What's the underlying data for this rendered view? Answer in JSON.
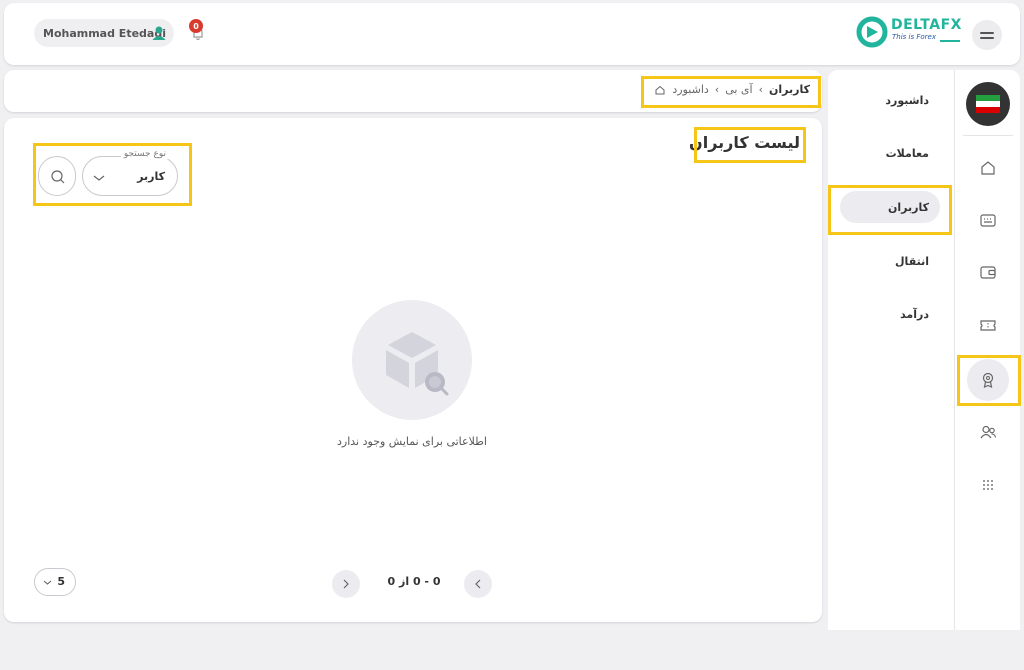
{
  "header": {
    "user_name": "Mohammad Etedadi",
    "notification_count": "0",
    "logo_name": "DELTAFX",
    "logo_tagline": "This is Forex"
  },
  "breadcrumb": {
    "home": "داشبورد",
    "parent": "آی بی",
    "current": "کاربران"
  },
  "sidebar": {
    "items": [
      {
        "label": "داشبورد"
      },
      {
        "label": "معاملات"
      },
      {
        "label": "کاربران",
        "active": true
      },
      {
        "label": "انتقال"
      },
      {
        "label": "درآمد"
      }
    ]
  },
  "rail": {
    "icons": [
      "home-icon",
      "keyboard-icon",
      "wallet-icon",
      "ticket-icon",
      "award-icon",
      "users-icon",
      "apps-grid-icon"
    ],
    "active": "award-icon"
  },
  "main": {
    "title": "لیست کاربران",
    "search_type_label": "نوع جستجو",
    "search_type_value": "کاربر",
    "empty_message": "اطلاعاتی برای نمایش وجود ندارد",
    "pagination_info": "0 - 0 از 0",
    "per_page": "5"
  },
  "colors": {
    "brand_teal": "#21b59d",
    "brand_blue": "#1e5aa8",
    "badge_red": "#d93a2e",
    "highlight": "#f5c518"
  }
}
